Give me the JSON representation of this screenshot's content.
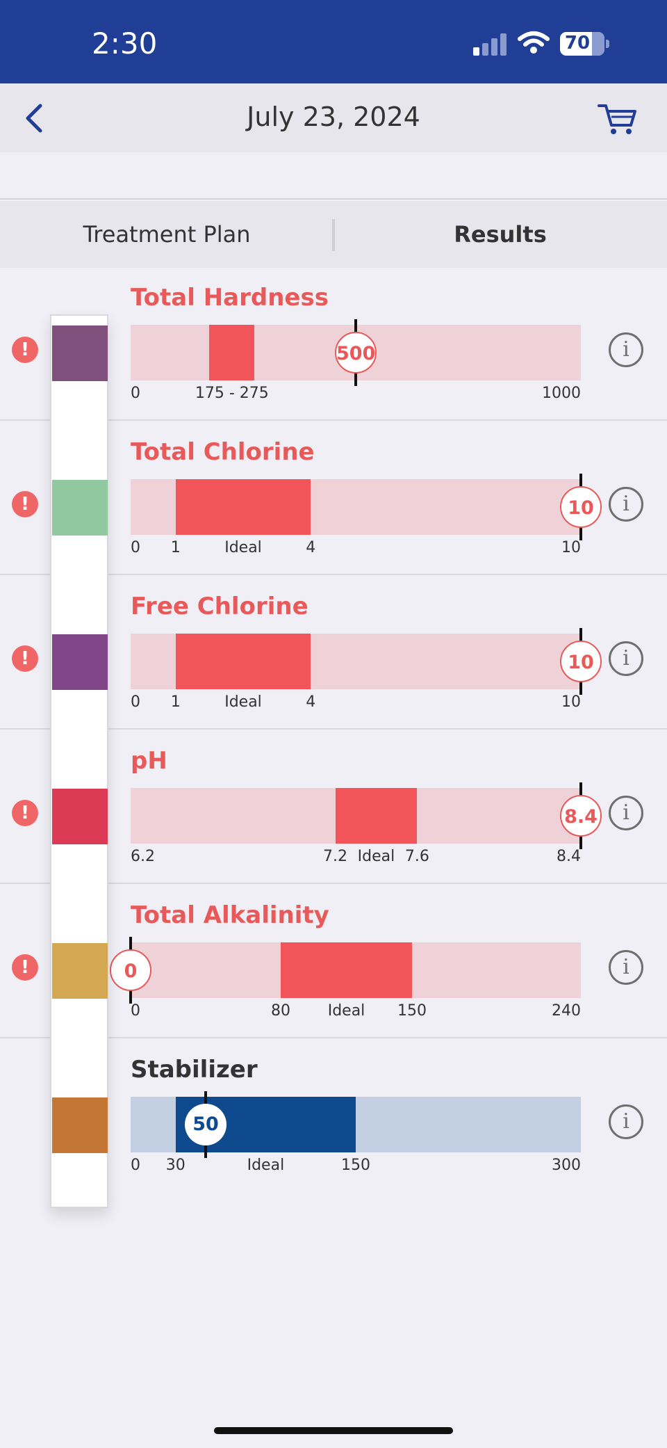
{
  "status_bar": {
    "time": "2:30",
    "battery": "70"
  },
  "header": {
    "title": "July 23, 2024",
    "back_icon": "chevron-left-icon",
    "cart_icon": "cart-icon"
  },
  "tabs": [
    {
      "label": "Treatment Plan",
      "selected": false
    },
    {
      "label": "Results",
      "selected": true
    }
  ],
  "colors": {
    "alert": "#f06565",
    "ideal_alert": "#f25559",
    "track_alert": "#efd2d8",
    "ideal_ok": "#0f4a8f",
    "track_ok": "#c3cfe2",
    "title_alert": "#e85a5a",
    "title_ok": "#333333"
  },
  "results": [
    {
      "name": "Total Hardness",
      "status": "alert",
      "pad_color": "#7f507c",
      "range": [
        0,
        1000
      ],
      "ideal": [
        175,
        275
      ],
      "value": 500,
      "value_label": "500",
      "labels": [
        {
          "text": "0",
          "at": 0
        },
        {
          "text": "175  -  275",
          "at": 225
        },
        {
          "text": "1000",
          "at": 1000
        }
      ]
    },
    {
      "name": "Total Chlorine",
      "status": "alert",
      "pad_color": "#90c9a0",
      "range": [
        0,
        10
      ],
      "ideal": [
        1,
        4
      ],
      "value": 10,
      "value_label": "10",
      "labels": [
        {
          "text": "0",
          "at": 0
        },
        {
          "text": "1",
          "at": 1
        },
        {
          "text": "Ideal",
          "at": 2.5
        },
        {
          "text": "4",
          "at": 4
        },
        {
          "text": "10",
          "at": 10
        }
      ]
    },
    {
      "name": "Free Chlorine",
      "status": "alert",
      "pad_color": "#81458a",
      "range": [
        0,
        10
      ],
      "ideal": [
        1,
        4
      ],
      "value": 10,
      "value_label": "10",
      "labels": [
        {
          "text": "0",
          "at": 0
        },
        {
          "text": "1",
          "at": 1
        },
        {
          "text": "Ideal",
          "at": 2.5
        },
        {
          "text": "4",
          "at": 4
        },
        {
          "text": "10",
          "at": 10
        }
      ]
    },
    {
      "name": "pH",
      "status": "alert",
      "pad_color": "#dc3b56",
      "range": [
        6.2,
        8.4
      ],
      "ideal": [
        7.2,
        7.6
      ],
      "value": 8.4,
      "value_label": "8.4",
      "labels": [
        {
          "text": "6.2",
          "at": 6.2
        },
        {
          "text": "7.2",
          "at": 7.2
        },
        {
          "text": "Ideal",
          "at": 7.4
        },
        {
          "text": "7.6",
          "at": 7.6
        },
        {
          "text": "8.4",
          "at": 8.4
        }
      ]
    },
    {
      "name": "Total Alkalinity",
      "status": "alert",
      "pad_color": "#d4a752",
      "range": [
        0,
        240
      ],
      "ideal": [
        80,
        150
      ],
      "value": 0,
      "value_label": "0",
      "labels": [
        {
          "text": "0",
          "at": 0
        },
        {
          "text": "80",
          "at": 80
        },
        {
          "text": "Ideal",
          "at": 115
        },
        {
          "text": "150",
          "at": 150
        },
        {
          "text": "240",
          "at": 240
        }
      ]
    },
    {
      "name": "Stabilizer",
      "status": "ok",
      "pad_color": "#c47634",
      "range": [
        0,
        300
      ],
      "ideal": [
        30,
        150
      ],
      "value": 50,
      "value_label": "50",
      "labels": [
        {
          "text": "0",
          "at": 0
        },
        {
          "text": "30",
          "at": 30
        },
        {
          "text": "Ideal",
          "at": 90
        },
        {
          "text": "150",
          "at": 150
        },
        {
          "text": "300",
          "at": 300
        }
      ]
    }
  ]
}
